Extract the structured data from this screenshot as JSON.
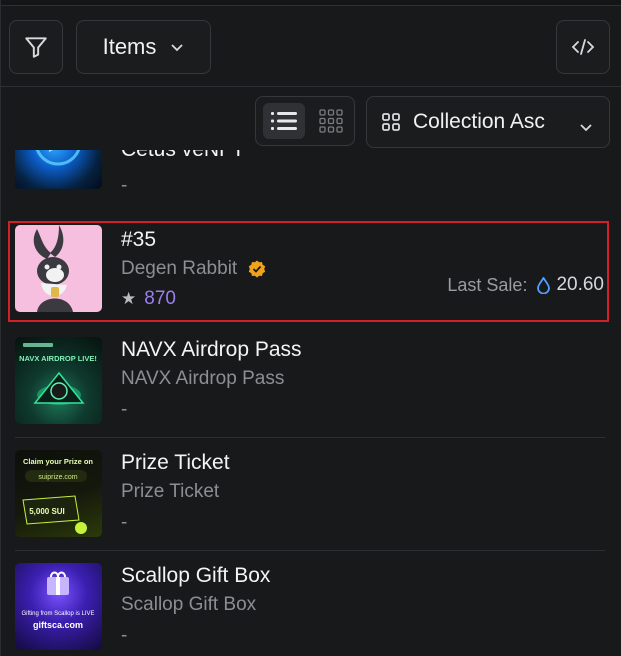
{
  "toolbar": {
    "items_label": "Items",
    "sort_label": "Collection Asc",
    "icons": [
      "filter-icon",
      "chevron-down-icon",
      "code-icon",
      "list-view-icon",
      "grid-view-icon",
      "grid-sort-icon"
    ]
  },
  "items": [
    {
      "title": "Cetus veNFT",
      "subtitle": "",
      "meta": "-"
    },
    {
      "title": "#35",
      "collection": "Degen Rabbit",
      "rank": "870",
      "last_sale_label": "Last Sale:",
      "last_sale_value": "20.60",
      "selected": true
    },
    {
      "title": "NAVX Airdrop Pass",
      "subtitle": "NAVX Airdrop Pass",
      "meta": "-",
      "thumb_text": [
        "NAVX AIRDROP LIVE!"
      ]
    },
    {
      "title": "Prize Ticket",
      "subtitle": "Prize Ticket",
      "meta": "-",
      "thumb_text": [
        "Claim your Prize on",
        "suiprize.com",
        "5,000 SUI"
      ]
    },
    {
      "title": "Scallop Gift Box",
      "subtitle": "Scallop Gift Box",
      "meta": "-",
      "thumb_text": [
        "Gifting from Scallop is LIVE",
        "giftsca.com"
      ]
    }
  ],
  "colors": {
    "selection_border": "#d41f2b",
    "rank": "#9b7ff0",
    "verified": "#f0a21b",
    "sui_drop": "#4da2ff"
  }
}
